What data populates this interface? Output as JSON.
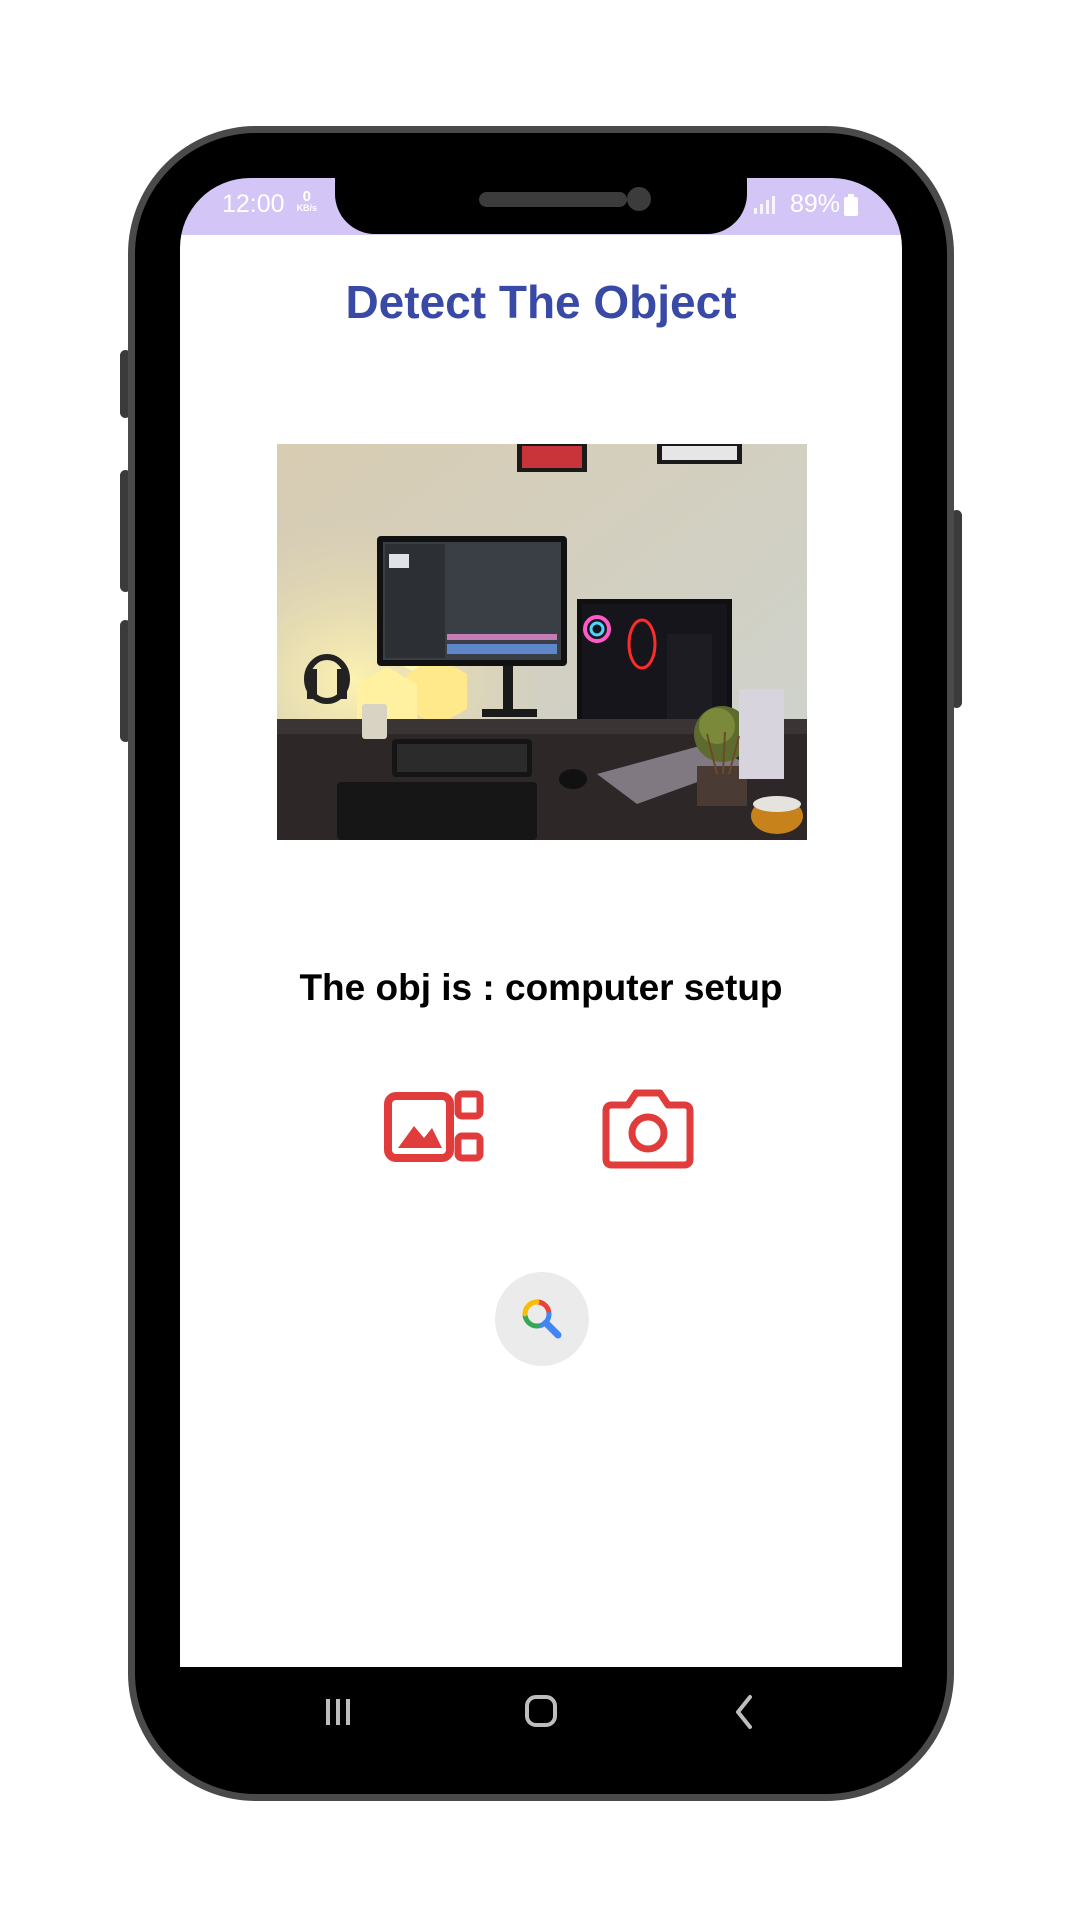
{
  "status_bar": {
    "time": "12:00",
    "data_rate_value": "0",
    "data_rate_unit": "KB/s",
    "battery_percent": "89%"
  },
  "app": {
    "title": "Detect The Object",
    "result_text": "The obj is : computer setup"
  },
  "icons": {
    "gallery": "gallery-icon",
    "camera": "camera-icon",
    "search": "search-icon",
    "nav_recents": "recents-icon",
    "nav_home": "home-icon",
    "nav_back": "back-icon"
  },
  "colors": {
    "title": "#3949a6",
    "action_icons": "#e03c3c",
    "status_bar": "#d3c6f7",
    "fab_background": "#ebebeb"
  }
}
